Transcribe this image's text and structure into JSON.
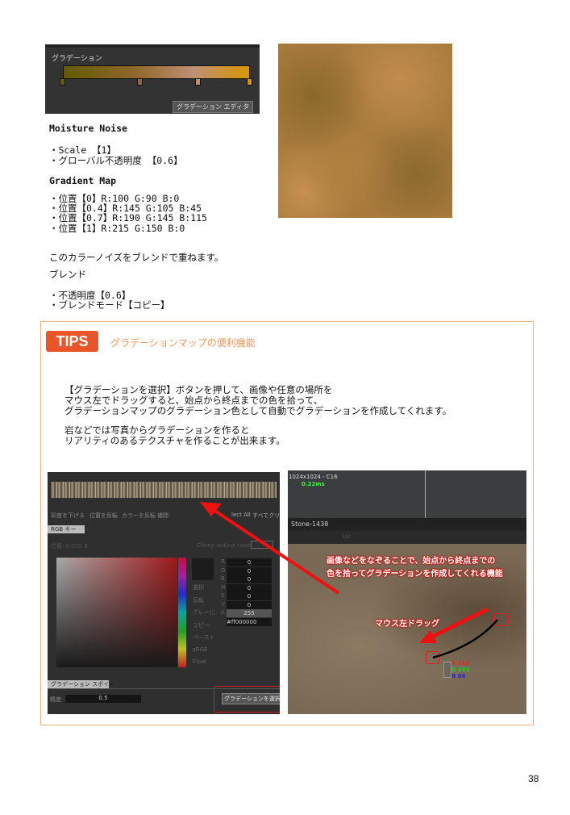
{
  "gradient_panel": {
    "label": "グラデーション",
    "editor_button": "グラデーション エディタ",
    "stops": [
      {
        "pos": 0,
        "color": "#645a00"
      },
      {
        "pos": 0.4,
        "color": "#91692d"
      },
      {
        "pos": 0.7,
        "color": "#be9173"
      },
      {
        "pos": 1,
        "color": "#d79600"
      }
    ]
  },
  "text": {
    "moisture_title": "Moisture Noise",
    "scale": "・Scale 【1】",
    "global_opacity": "・グローバル不透明度 【0.6】",
    "gradient_title": "Gradient Map",
    "pos0": "・位置【0】R:100 G:90 B:0",
    "pos04": "・位置【0.4】R:145 G:105 B:45",
    "pos07": "・位置【0.7】R:190 G:145 B:115",
    "pos1": "・位置【1】R:215 G:150 B:0",
    "blend_intro": "このカラーノイズをブレンドで重ねます。",
    "blend_title": "ブレンド",
    "opacity": "・不透明度【0.6】",
    "blend_mode": "・ブレンドモード【コピー】"
  },
  "tips": {
    "badge": "TIPS",
    "title": "グラデーションマップの便利機能",
    "lines": [
      "【グラデーションを選択】ボタンを押して、画像や任意の場所を",
      "マウス左でドラッグすると、始点から終点までの色を拾って、",
      "グラデーションマップのグラデーション色として自動でグラデーションを作成してくれます。",
      "岩などでは写真からグラデーションを作ると",
      "リアリティのあるテクスチャを作ることが出来ます。"
    ]
  },
  "editor": {
    "menu": [
      "彩度を下げる",
      "位置を反転",
      "カラーを反転",
      "補間"
    ],
    "select_all": "lect All",
    "clear_all": "すべてクリア",
    "tab_rgb": "RGB キー",
    "position_label": "位置: 0.000 ⬍",
    "clamp": "Clamp output color",
    "side": [
      "選択",
      "反転",
      "グレーに",
      "コピー",
      "ペースト",
      "sRGB",
      "Float"
    ],
    "channels": [
      {
        "k": "R",
        "v": "0"
      },
      {
        "k": "G",
        "v": "0"
      },
      {
        "k": "B",
        "v": "0"
      },
      {
        "k": "H",
        "v": "0"
      },
      {
        "k": "S",
        "v": "0"
      },
      {
        "k": "V",
        "v": "0"
      },
      {
        "k": "A",
        "v": "255"
      }
    ],
    "hex": "#ff000000",
    "tab_picker": "グラデーション スポイト",
    "precision_label": "精度",
    "precision_value": "0.5",
    "select_gradient_button": "グラデーションを選択"
  },
  "viewport": {
    "res": "1024x1024 - C16",
    "time": "0.22ms",
    "title": "Stone-1438",
    "uv": "UV",
    "annotation1": "画像などをなぞることで、始点から終点までの",
    "annotation2": "色を拾ってグラデーションを作成してくれる機能",
    "annotation_drag": "マウス左ドラッグ",
    "r": "R 110",
    "g": "G 101",
    "b": "B 86"
  },
  "page_number": "38",
  "colors": {
    "accent": "#e8552a",
    "tips_title": "#f0985a",
    "arrow": "#ee1111"
  }
}
